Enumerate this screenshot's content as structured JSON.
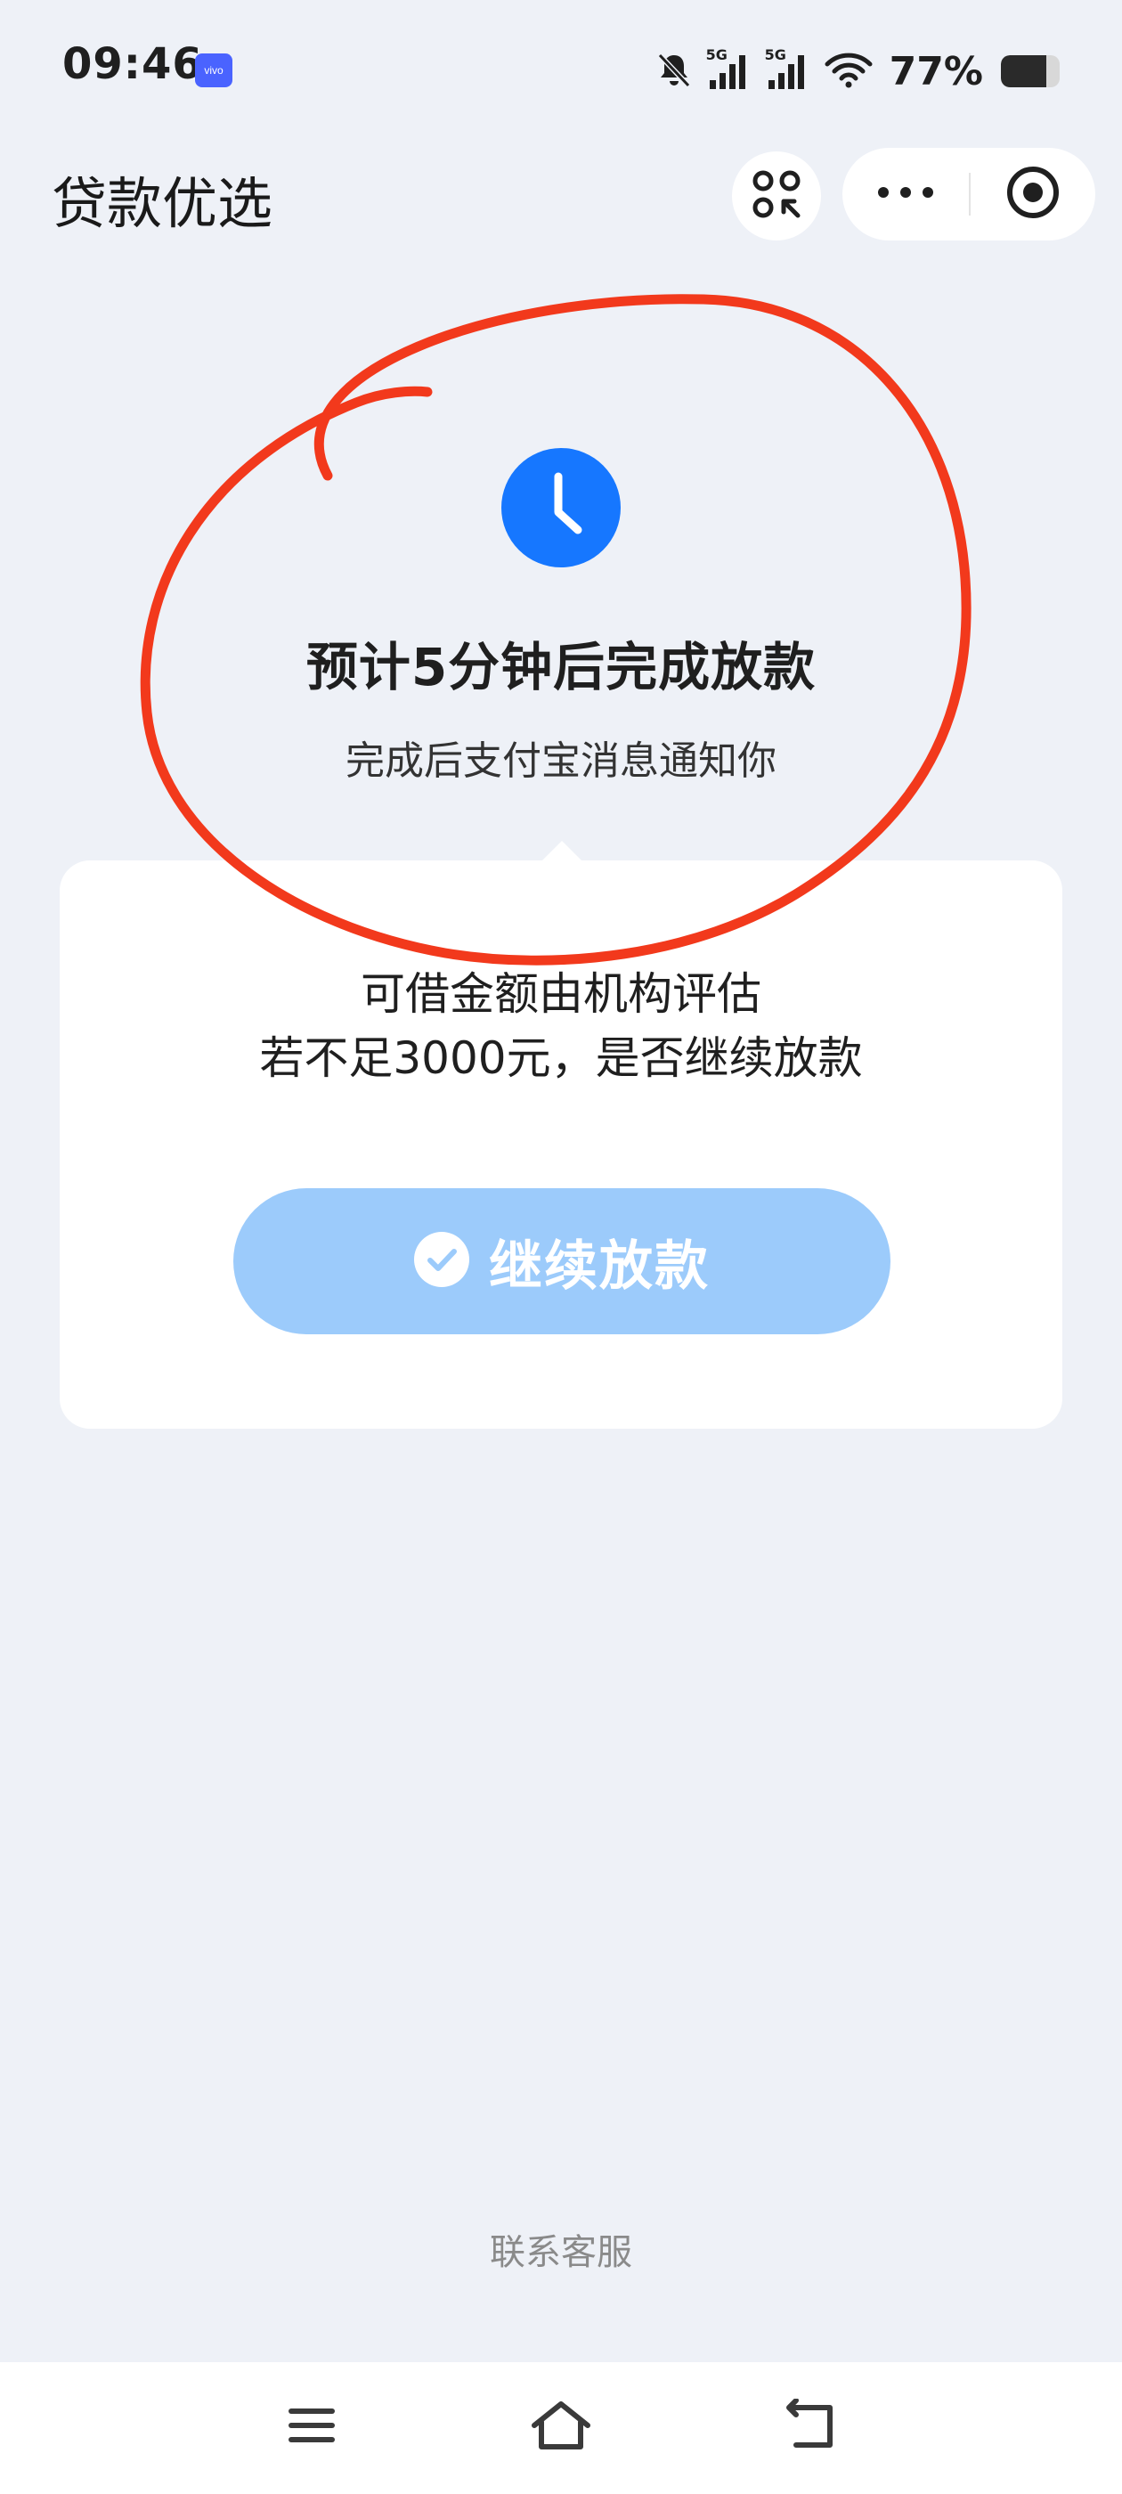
{
  "status_bar": {
    "time": "09:46",
    "brand_badge": "vivo",
    "network1": "5G",
    "network2": "5G",
    "battery_text": "77%",
    "battery_level": 0.77
  },
  "header": {
    "title": "贷款优选"
  },
  "status": {
    "title": "预计5分钟后完成放款",
    "subtitle": "完成后支付宝消息通知你"
  },
  "card": {
    "line1": "可借金额由机构评估",
    "line2": "若不足3000元，是否继续放款",
    "continue_label": "继续放款"
  },
  "footer": {
    "contact_label": "联系客服"
  },
  "colors": {
    "accent_blue": "#1677ff",
    "button_disabled": "#9ccbfb",
    "annotation_red": "#f2391c",
    "background": "#eef1f7"
  },
  "icons": {
    "clock": "clock-icon",
    "scan": "scan-icon",
    "more": "more-icon",
    "close": "miniapp-close-icon",
    "check": "check-circle-icon",
    "menu": "menu-icon",
    "home": "home-icon",
    "back": "back-icon"
  }
}
